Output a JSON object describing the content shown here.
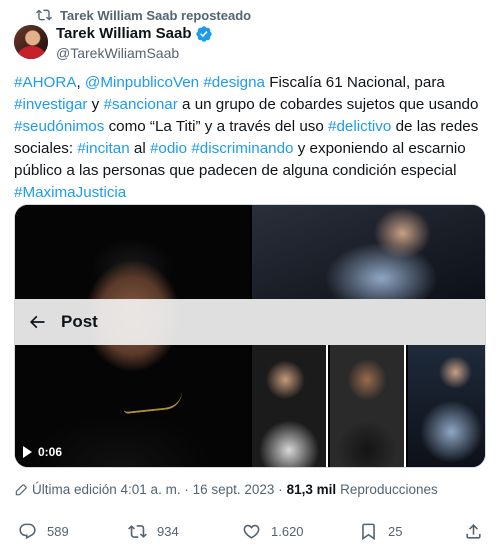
{
  "repost": {
    "label": "Tarek William Saab reposteado",
    "icon": "repost-icon"
  },
  "author": {
    "name": "Tarek William Saab",
    "handle": "@TarekWiliamSaab",
    "verified": true,
    "verified_color": "#1d9bf0"
  },
  "tweet": {
    "segments": [
      {
        "text": "#AHORA",
        "tag": true
      },
      {
        "text": ", ",
        "tag": false
      },
      {
        "text": "@MinpublicoVen",
        "tag": true
      },
      {
        "text": " ",
        "tag": false
      },
      {
        "text": "#designa",
        "tag": true
      },
      {
        "text": " Fiscalía 61 Nacional, para ",
        "tag": false
      },
      {
        "text": "#investigar",
        "tag": true
      },
      {
        "text": " y ",
        "tag": false
      },
      {
        "text": "#sancionar",
        "tag": true
      },
      {
        "text": " a un grupo de cobardes sujetos que usando ",
        "tag": false
      },
      {
        "text": "#seudónimos",
        "tag": true
      },
      {
        "text": " como “La Titi”  y  a través del uso ",
        "tag": false
      },
      {
        "text": "#delictivo",
        "tag": true
      },
      {
        "text": " de las redes sociales: ",
        "tag": false
      },
      {
        "text": "#incitan",
        "tag": true
      },
      {
        "text": " al ",
        "tag": false
      },
      {
        "text": "#odio",
        "tag": true
      },
      {
        "text": " ",
        "tag": false
      },
      {
        "text": "#discriminando",
        "tag": true
      },
      {
        "text": "  y exponiendo al escarnio público a las personas que padecen de alguna condición especial ",
        "tag": false
      },
      {
        "text": "#MaximaJusticia",
        "tag": true
      }
    ],
    "link_color": "#1d9bf0"
  },
  "media": {
    "overlay_title": "Post",
    "video_duration": "0:06"
  },
  "meta": {
    "edited": "Última edición 4:01 a. m. · 16 sept. 2023 · ",
    "views_count": "81,3 mil",
    "views_label": " Reproducciones"
  },
  "actions": {
    "replies": "589",
    "reposts": "934",
    "likes": "1.620",
    "bookmarks": "25"
  },
  "colors": {
    "text": "#0f1419",
    "secondary": "#536471"
  }
}
